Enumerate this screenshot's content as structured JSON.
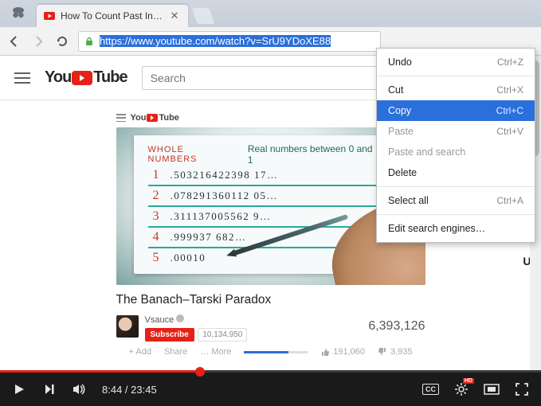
{
  "browser": {
    "tab": {
      "title": "How To Count Past Infinity"
    },
    "omnibox": {
      "url": "https://www.youtube.com/watch?v=SrU9YDoXE88"
    }
  },
  "context_menu": {
    "items": [
      {
        "label": "Undo",
        "shortcut": "Ctrl+Z",
        "state": "normal"
      },
      {
        "sep": true
      },
      {
        "label": "Cut",
        "shortcut": "Ctrl+X",
        "state": "normal"
      },
      {
        "label": "Copy",
        "shortcut": "Ctrl+C",
        "state": "hover"
      },
      {
        "label": "Paste",
        "shortcut": "Ctrl+V",
        "state": "disabled"
      },
      {
        "label": "Paste and search",
        "shortcut": "",
        "state": "disabled"
      },
      {
        "label": "Delete",
        "shortcut": "",
        "state": "normal"
      },
      {
        "sep": true
      },
      {
        "label": "Select all",
        "shortcut": "Ctrl+A",
        "state": "normal"
      },
      {
        "sep": true
      },
      {
        "label": "Edit search engines…",
        "shortcut": "",
        "state": "normal"
      }
    ]
  },
  "youtube": {
    "logo_you": "You",
    "logo_tube": "Tube",
    "search_placeholder": "Search",
    "video": {
      "title": "The Banach–Tarski Paradox",
      "channel": "Vsauce",
      "subscribe_label": "Subscribe",
      "sub_count": "10,134,950",
      "views": "6,393,126",
      "likes": "191,060",
      "dislikes": "3,935",
      "add_label": "+ Add",
      "share_label": "Share",
      "more_label": "… More",
      "sheet": {
        "heading_left": "WHOLE NUMBERS",
        "heading_right": "Real numbers between 0 and 1",
        "rows": [
          {
            "i": "1",
            "n": ".503216422398 17…"
          },
          {
            "i": "2",
            "n": ".078291360112 05…"
          },
          {
            "i": "3",
            "n": ".311137005562 9…"
          },
          {
            "i": "4",
            "n": ".999937    682…"
          },
          {
            "i": "5",
            "n": ".00010"
          }
        ]
      }
    },
    "upnext": "Up",
    "player": {
      "time": "8:44 / 23:45",
      "cc": "CC",
      "hd": "HD"
    }
  }
}
